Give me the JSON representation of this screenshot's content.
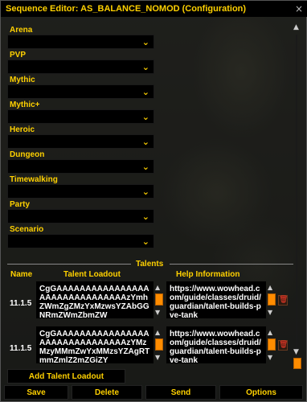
{
  "window": {
    "title": "Sequence Editor: AS_BALANCE_NOMOD (Configuration)",
    "close_label": "×"
  },
  "environments": [
    {
      "label": "Arena"
    },
    {
      "label": "PVP"
    },
    {
      "label": "Mythic"
    },
    {
      "label": "Mythic+"
    },
    {
      "label": "Heroic"
    },
    {
      "label": "Dungeon"
    },
    {
      "label": "Timewalking"
    },
    {
      "label": "Party"
    },
    {
      "label": "Scenario"
    }
  ],
  "icons": {
    "chevron": "⌄",
    "up": "▲",
    "down": "▼",
    "trash": "🗑"
  },
  "talents": {
    "section_label": "Talents",
    "headers": {
      "name": "Name",
      "loadout": "Talent Loadout",
      "help": "Help Information"
    },
    "rows": [
      {
        "name": "11.1.5",
        "loadout": "CgGAAAAAAAAAAAAAAAAAAAAAAAAAAAAAAAzYmhZWmZgZMzYxMzwsYZAbGGNRmZWmZbmZW",
        "help": "https://www.wowhead.com/guide/classes/druid/guardian/talent-builds-pve-tank"
      },
      {
        "name": "11.1.5",
        "loadout": "CgGAAAAAAAAAAAAAAAAAAAAAAAAAAAAAAAzYMzMzyMMmZwYxMMzsYZAgRTmmZmlZ2mZGiZY",
        "help": "https://www.wowhead.com/guide/classes/druid/guardian/talent-builds-pve-tank"
      }
    ]
  },
  "buttons": {
    "add_talent": "Add Talent Loadout",
    "save": "Save",
    "delete": "Delete",
    "send": "Send",
    "options": "Options"
  },
  "colors": {
    "label_gold": "#ffd100",
    "accent_orange": "#ff8c00"
  }
}
